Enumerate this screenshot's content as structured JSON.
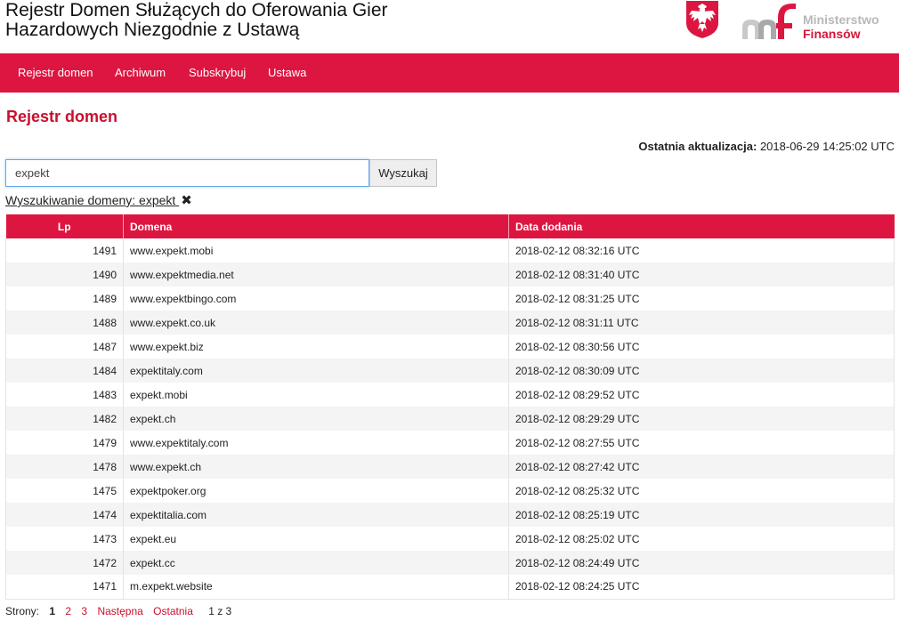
{
  "header": {
    "title": "Rejestr Domen Służących do Oferowania Gier Hazardowych Niezgodnie z Ustawą",
    "ministry_line1": "Ministerstwo",
    "ministry_line2": "Finansów"
  },
  "nav": {
    "items": [
      {
        "label": "Rejestr domen"
      },
      {
        "label": "Archiwum"
      },
      {
        "label": "Subskrybuj"
      },
      {
        "label": "Ustawa"
      }
    ]
  },
  "page": {
    "title": "Rejestr domen",
    "last_update_label": "Ostatnia aktualizacja:",
    "last_update_value": "2018-06-29 14:25:02 UTC"
  },
  "search": {
    "value": "expekt",
    "button_label": "Wyszukaj",
    "filter_label": "Wyszukiwanie domeny: expekt",
    "filter_clear_icon": "close-icon"
  },
  "table": {
    "columns": [
      "Lp",
      "Domena",
      "Data dodania"
    ],
    "rows": [
      {
        "lp": "1491",
        "domain": "www.expekt.mobi",
        "date": "2018-02-12 08:32:16 UTC"
      },
      {
        "lp": "1490",
        "domain": "www.expektmedia.net",
        "date": "2018-02-12 08:31:40 UTC"
      },
      {
        "lp": "1489",
        "domain": "www.expektbingo.com",
        "date": "2018-02-12 08:31:25 UTC"
      },
      {
        "lp": "1488",
        "domain": "www.expekt.co.uk",
        "date": "2018-02-12 08:31:11 UTC"
      },
      {
        "lp": "1487",
        "domain": "www.expekt.biz",
        "date": "2018-02-12 08:30:56 UTC"
      },
      {
        "lp": "1484",
        "domain": "expektitaly.com",
        "date": "2018-02-12 08:30:09 UTC"
      },
      {
        "lp": "1483",
        "domain": "expekt.mobi",
        "date": "2018-02-12 08:29:52 UTC"
      },
      {
        "lp": "1482",
        "domain": "expekt.ch",
        "date": "2018-02-12 08:29:29 UTC"
      },
      {
        "lp": "1479",
        "domain": "www.expektitaly.com",
        "date": "2018-02-12 08:27:55 UTC"
      },
      {
        "lp": "1478",
        "domain": "www.expekt.ch",
        "date": "2018-02-12 08:27:42 UTC"
      },
      {
        "lp": "1475",
        "domain": "expektpoker.org",
        "date": "2018-02-12 08:25:32 UTC"
      },
      {
        "lp": "1474",
        "domain": "expektitalia.com",
        "date": "2018-02-12 08:25:19 UTC"
      },
      {
        "lp": "1473",
        "domain": "expekt.eu",
        "date": "2018-02-12 08:25:02 UTC"
      },
      {
        "lp": "1472",
        "domain": "expekt.cc",
        "date": "2018-02-12 08:24:49 UTC"
      },
      {
        "lp": "1471",
        "domain": "m.expekt.website",
        "date": "2018-02-12 08:24:25 UTC"
      }
    ]
  },
  "pager": {
    "label": "Strony:",
    "current": "1",
    "pages": [
      "2",
      "3"
    ],
    "next_label": "Następna",
    "last_label": "Ostatnia",
    "count": "1 z 3"
  },
  "colors": {
    "brand_red": "#dc1640",
    "accent_red": "#c8102e",
    "input_focus": "#66a7e6"
  },
  "icons": {
    "emblem": "polish-eagle-emblem",
    "ministry_logo": "ministry-finance-logo"
  }
}
